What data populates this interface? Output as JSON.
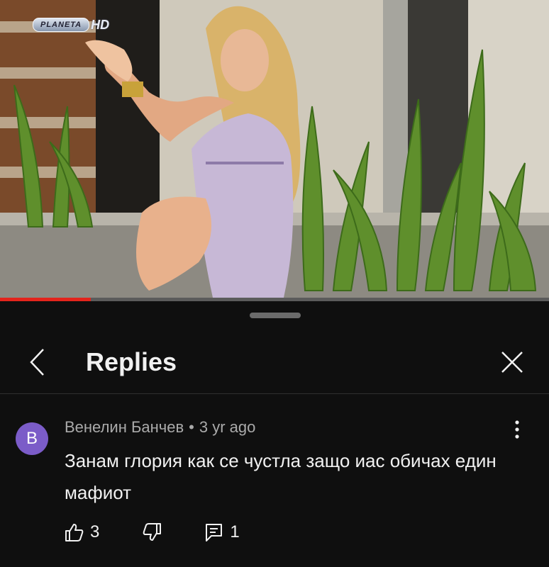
{
  "video": {
    "channel_logo_text": "PLANETA",
    "channel_logo_hd": "HD",
    "progress_fraction": 0.165
  },
  "sheet": {
    "title": "Replies",
    "icons": {
      "back": "chevron-left-icon",
      "close": "close-icon"
    }
  },
  "comment": {
    "avatar_letter": "B",
    "avatar_color": "#7b5cc8",
    "author": "Венелин Банчев",
    "separator": "•",
    "time": "3 yr ago",
    "text": "Занам глория как се чустла защо иас обичах един мафиот",
    "likes": "3",
    "replies": "1",
    "icons": {
      "like": "thumbs-up-icon",
      "dislike": "thumbs-down-icon",
      "reply": "reply-comment-icon",
      "more": "more-vert-icon"
    }
  },
  "colors": {
    "accent": "#e3241c",
    "background": "#0f0f0f",
    "secondary_text": "#aaaaaa"
  }
}
